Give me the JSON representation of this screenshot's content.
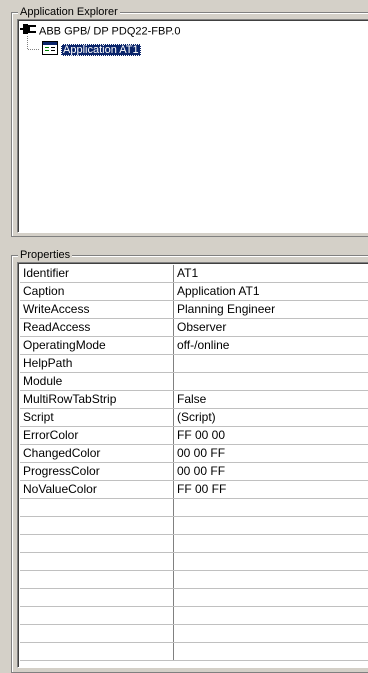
{
  "explorer": {
    "title": "Application Explorer",
    "root": {
      "label": "ABB GPB/ DP PDQ22-FBP.0",
      "icon": "plug-device-icon"
    },
    "child": {
      "label": "Application AT1",
      "icon": "application-window-icon",
      "selected": true
    }
  },
  "properties": {
    "title": "Properties",
    "rows": [
      {
        "key": "Identifier",
        "value": "AT1"
      },
      {
        "key": "Caption",
        "value": "Application AT1"
      },
      {
        "key": "WriteAccess",
        "value": "Planning Engineer"
      },
      {
        "key": "ReadAccess",
        "value": "Observer"
      },
      {
        "key": "OperatingMode",
        "value": "off-/online"
      },
      {
        "key": "HelpPath",
        "value": ""
      },
      {
        "key": "Module",
        "value": ""
      },
      {
        "key": "MultiRowTabStrip",
        "value": "False"
      },
      {
        "key": "Script",
        "value": "(Script)"
      },
      {
        "key": "ErrorColor",
        "value": "FF 00 00"
      },
      {
        "key": "ChangedColor",
        "value": "00 00 FF"
      },
      {
        "key": "ProgressColor",
        "value": "00 00 FF"
      },
      {
        "key": "NoValueColor",
        "value": "FF 00 FF"
      }
    ],
    "empty_rows": 9
  }
}
